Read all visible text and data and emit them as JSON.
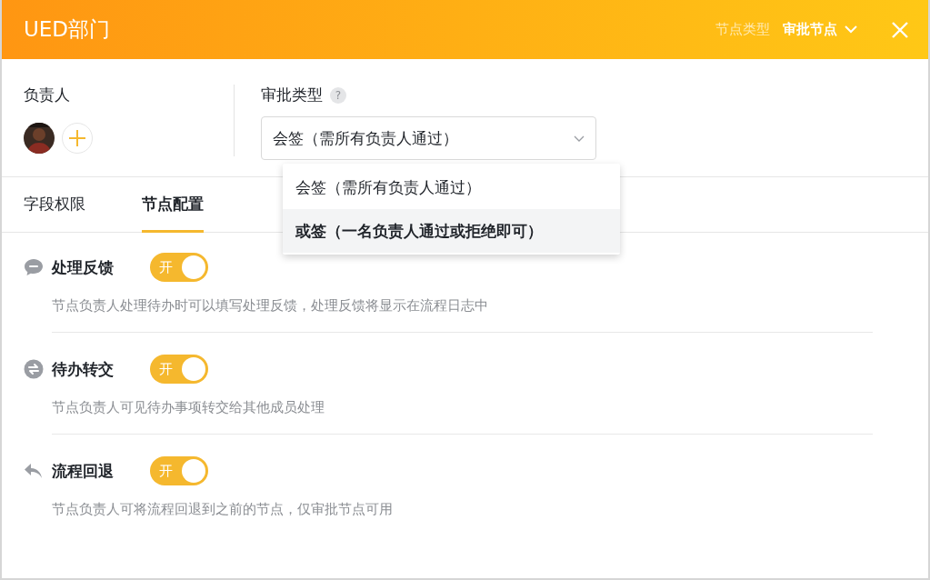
{
  "header": {
    "title": "UED部门",
    "node_type_label": "节点类型",
    "node_type_value": "审批节点"
  },
  "owner": {
    "label": "负责人"
  },
  "approval": {
    "label": "审批类型",
    "help": "?",
    "value": "会签（需所有负责人通过）",
    "expanded": true,
    "options": [
      {
        "label": "会签（需所有负责人通过）",
        "highlighted": false
      },
      {
        "label": "或签（一名负责人通过或拒绝即可）",
        "highlighted": true
      }
    ]
  },
  "tabs": [
    {
      "label": "字段权限",
      "selected": false
    },
    {
      "label": "节点配置",
      "selected": true
    }
  ],
  "settings": [
    {
      "kind": "feedback",
      "title": "处理反馈",
      "on": true,
      "switch_label": "开",
      "description": "节点负责人处理待办时可以填写处理反馈，处理反馈将显示在流程日志中"
    },
    {
      "kind": "transfer",
      "title": "待办转交",
      "on": true,
      "switch_label": "开",
      "description": "节点负责人可见待办事项转交给其他成员处理"
    },
    {
      "kind": "rollback",
      "title": "流程回退",
      "on": true,
      "switch_label": "开",
      "description": "节点负责人可将流程回退到之前的节点，仅审批节点可用"
    }
  ]
}
